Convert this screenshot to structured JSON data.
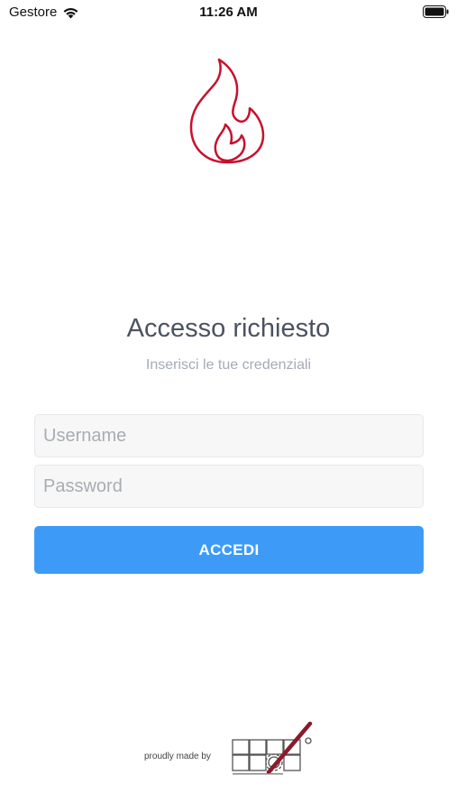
{
  "status_bar": {
    "carrier": "Gestore",
    "time": "11:26 AM"
  },
  "login": {
    "title": "Accesso richiesto",
    "subtitle": "Inserisci le tue credenziali",
    "username_placeholder": "Username",
    "password_placeholder": "Password",
    "submit_label": "ACCEDI"
  },
  "footer": {
    "made_by": "proudly made by"
  },
  "colors": {
    "accent": "#3d9bf7",
    "logo_red": "#c8102e",
    "title_text": "#4b5262",
    "subtitle_text": "#a4abb7"
  },
  "icons": [
    "wifi-icon",
    "battery-icon",
    "flame-logo-icon",
    "company-logo"
  ]
}
